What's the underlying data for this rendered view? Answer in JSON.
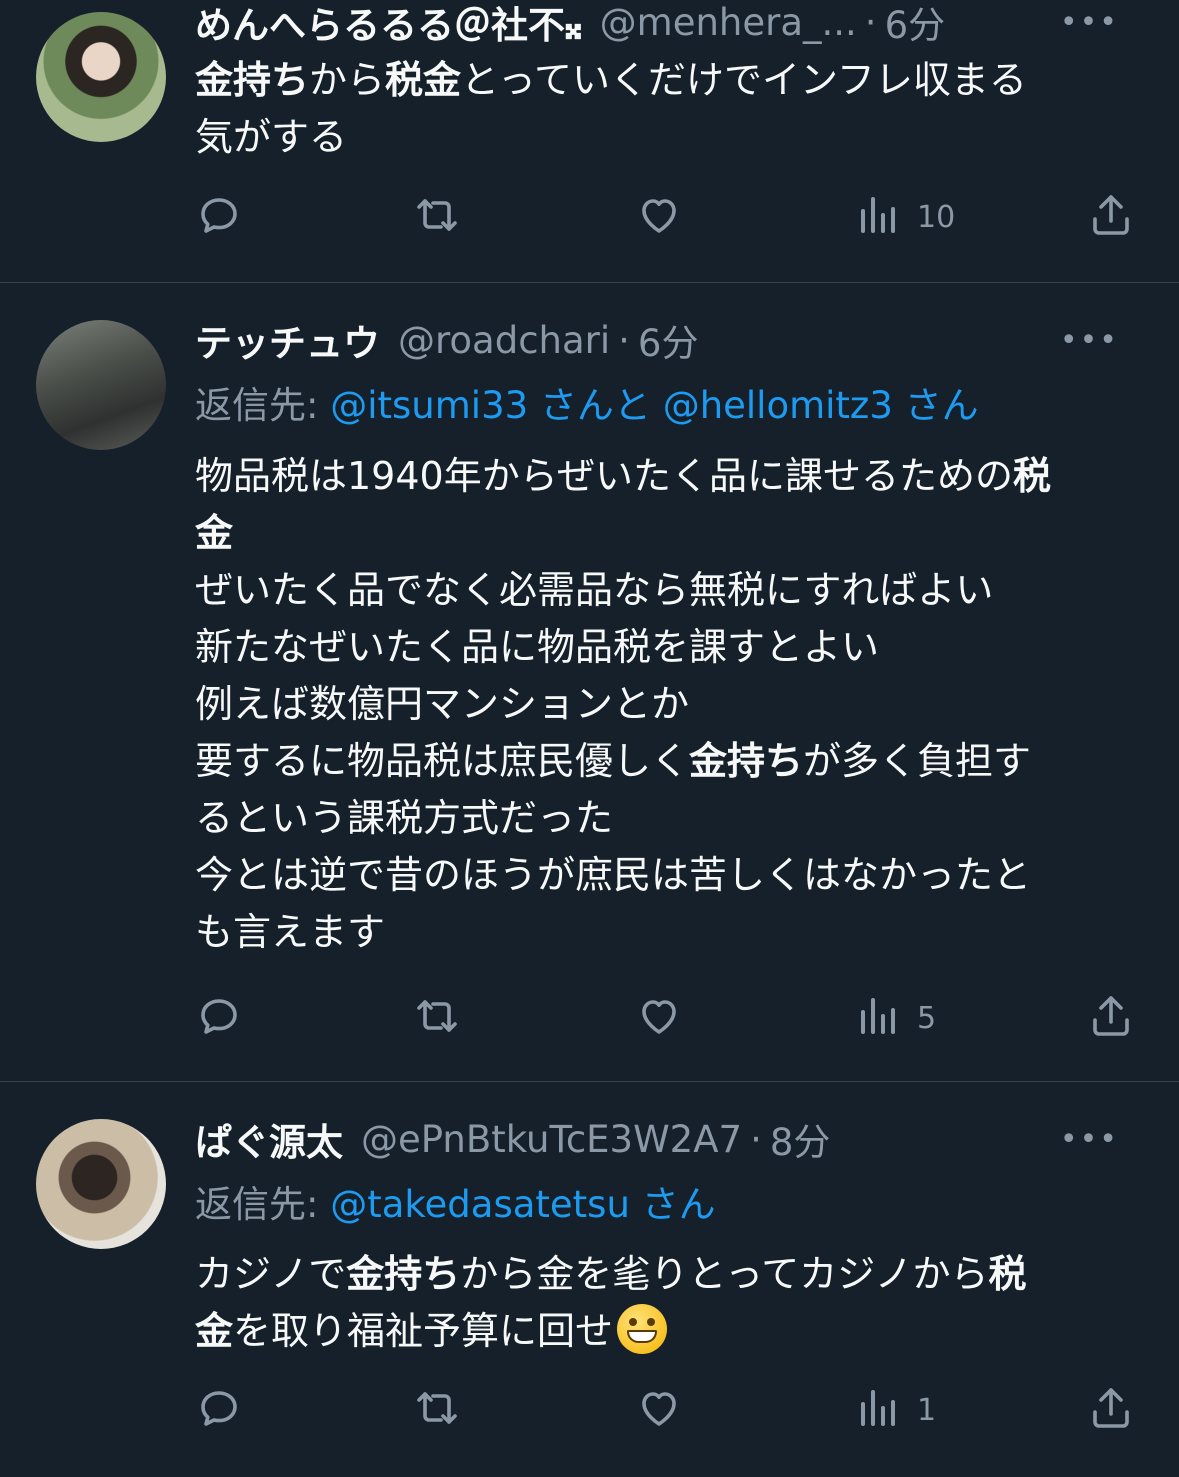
{
  "tweets": [
    {
      "name": "めんへらるるる＠社不𝄪",
      "handle": "@menhera_...",
      "time": "6分",
      "reply_to_label": "",
      "body": [
        [
          {
            "t": "金持ち",
            "b": true
          },
          {
            "t": "から",
            "b": false
          },
          {
            "t": "税金",
            "b": true
          },
          {
            "t": "とっていくだけでインフレ収まる",
            "b": false
          }
        ],
        [
          {
            "t": "気がする",
            "b": false
          }
        ]
      ],
      "views": "10"
    },
    {
      "name": "テッチュウ",
      "handle": "@roadchari",
      "time": "6分",
      "reply_to_label": "返信先:",
      "reply_mentions": [
        "@itsumi33",
        "さんと",
        "@hellomitz3",
        "さん"
      ],
      "body": [
        [
          {
            "t": "物品税は1940年からぜいたく品に課せるための",
            "b": false
          },
          {
            "t": "税",
            "b": true
          }
        ],
        [
          {
            "t": "金",
            "b": true
          }
        ],
        [
          {
            "t": "ぜいたく品でなく必需品なら無税にすればよい",
            "b": false
          }
        ],
        [
          {
            "t": "新たなぜいたく品に物品税を課すとよい",
            "b": false
          }
        ],
        [
          {
            "t": "例えば数億円マンションとか",
            "b": false
          }
        ],
        [
          {
            "t": "要するに物品税は庶民優しく",
            "b": false
          },
          {
            "t": "金持ち",
            "b": true
          },
          {
            "t": "が多く負担す",
            "b": false
          }
        ],
        [
          {
            "t": "るという課税方式だった",
            "b": false
          }
        ],
        [
          {
            "t": "今とは逆で昔のほうが庶民は苦しくはなかったと",
            "b": false
          }
        ],
        [
          {
            "t": "も言えます",
            "b": false
          }
        ]
      ],
      "views": "5"
    },
    {
      "name": "ぱぐ源太",
      "handle": "@ePnBtkuTcE3W2A7",
      "time": "8分",
      "reply_to_label": "返信先:",
      "reply_mentions": [
        "@takedasatetsu",
        "さん"
      ],
      "body": [
        [
          {
            "t": "カジノで",
            "b": false
          },
          {
            "t": "金持ち",
            "b": true
          },
          {
            "t": "から金を毟りとってカジノから",
            "b": false
          },
          {
            "t": "税",
            "b": true
          }
        ],
        [
          {
            "t": "金",
            "b": true
          },
          {
            "t": "を取り福祉予算に回せ",
            "b": false
          }
        ]
      ],
      "emoji": "grinning-face-emoji",
      "views": "1"
    }
  ],
  "ui": {
    "more_label": "•••",
    "separator": "·"
  },
  "colors": {
    "background": "#15202b",
    "text": "#f7f9f9",
    "secondary": "#8b98a5",
    "link": "#1d9bf0",
    "divider": "#38444d"
  },
  "icons": [
    "reply-icon",
    "retweet-icon",
    "like-icon",
    "views-icon",
    "share-icon"
  ]
}
